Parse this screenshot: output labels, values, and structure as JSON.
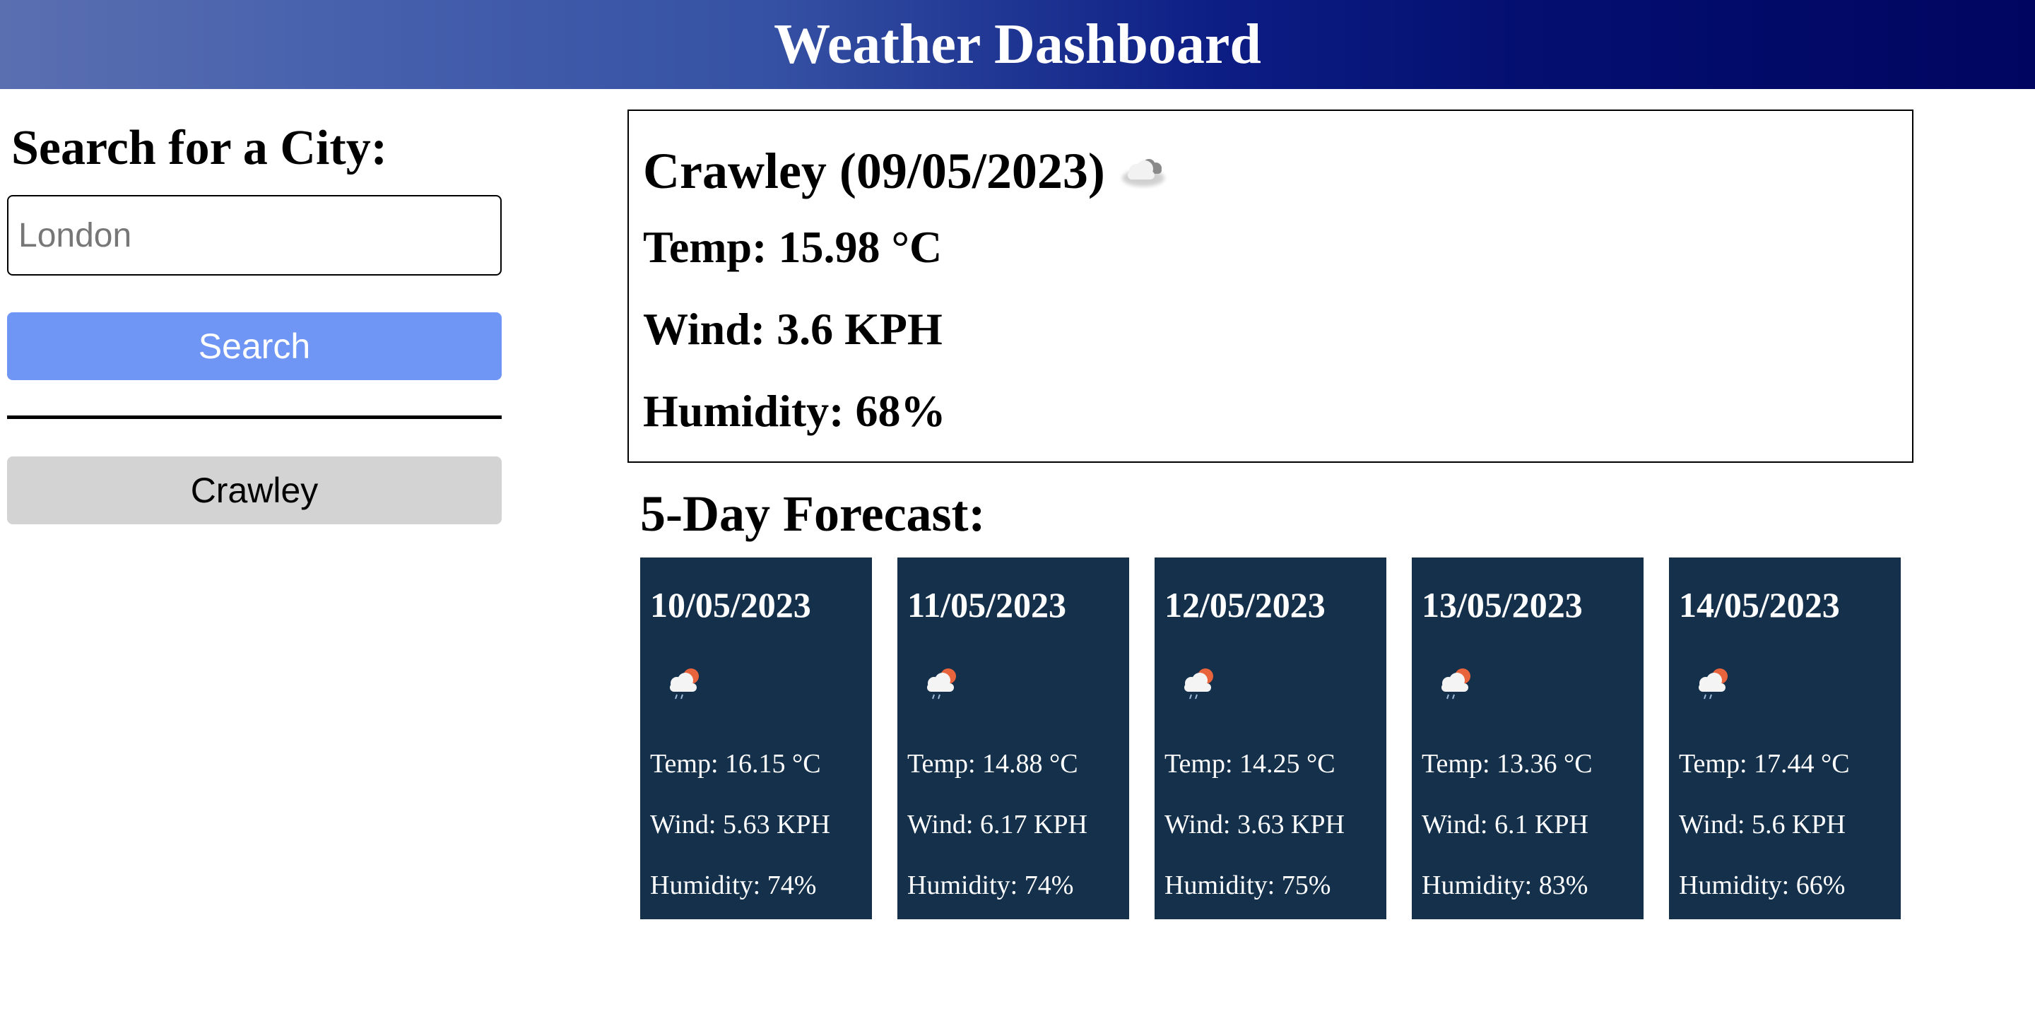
{
  "header": {
    "title": "Weather Dashboard"
  },
  "sidebar": {
    "title": "Search for a City:",
    "input_placeholder": "London",
    "input_value": "",
    "search_label": "Search",
    "history": [
      "Crawley"
    ]
  },
  "current": {
    "title": "Crawley (09/05/2023)",
    "icon": "cloudy-icon",
    "temp": "Temp: 15.98 °C",
    "wind": "Wind: 3.6 KPH",
    "humidity": "Humidity: 68%"
  },
  "forecast": {
    "title": "5-Day Forecast:",
    "days": [
      {
        "date": "10/05/2023",
        "icon": "light-rain-sun-icon",
        "temp": "Temp: 16.15 °C",
        "wind": "Wind: 5.63 KPH",
        "humidity": "Humidity: 74%"
      },
      {
        "date": "11/05/2023",
        "icon": "light-rain-sun-icon",
        "temp": "Temp: 14.88 °C",
        "wind": "Wind: 6.17 KPH",
        "humidity": "Humidity: 74%"
      },
      {
        "date": "12/05/2023",
        "icon": "light-rain-sun-icon",
        "temp": "Temp: 14.25 °C",
        "wind": "Wind: 3.63 KPH",
        "humidity": "Humidity: 75%"
      },
      {
        "date": "13/05/2023",
        "icon": "light-rain-sun-icon",
        "temp": "Temp: 13.36 °C",
        "wind": "Wind: 6.1 KPH",
        "humidity": "Humidity: 83%"
      },
      {
        "date": "14/05/2023",
        "icon": "light-rain-sun-icon",
        "temp": "Temp: 17.44 °C",
        "wind": "Wind: 5.6 KPH",
        "humidity": "Humidity: 66%"
      }
    ]
  },
  "colors": {
    "header_gradient_start": "#5a6fb0",
    "header_gradient_end": "#000560",
    "search_button": "#7096f5",
    "history_button": "#d3d3d3",
    "forecast_card": "#14304b"
  }
}
